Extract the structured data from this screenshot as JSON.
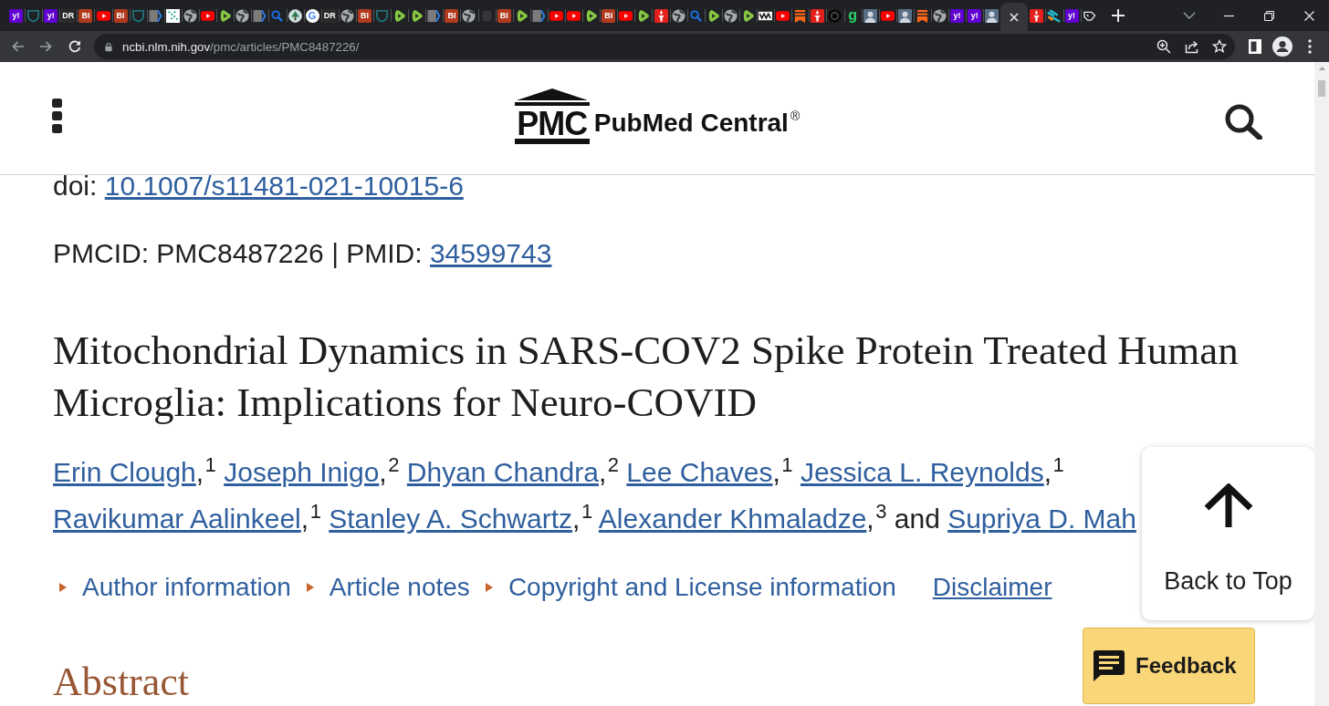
{
  "browser": {
    "tabs": [
      {
        "kind": "tile",
        "glyph": "y!",
        "color": "#6001d2",
        "selected": false
      },
      {
        "kind": "shield",
        "selected": false
      },
      {
        "kind": "tile",
        "glyph": "y!",
        "color": "#6001d2",
        "selected": false
      },
      {
        "kind": "tile",
        "glyph": "DR",
        "color": "#2b2b2b",
        "selected": false
      },
      {
        "kind": "tile",
        "glyph": "BI",
        "color": "#b23a1f",
        "selected": false
      },
      {
        "kind": "video",
        "selected": false
      },
      {
        "kind": "tile",
        "glyph": "BI",
        "color": "#b23a1f",
        "selected": false
      },
      {
        "kind": "shield",
        "selected": false
      },
      {
        "kind": "chevron",
        "selected": false
      },
      {
        "kind": "dots",
        "selected": false
      },
      {
        "kind": "globe",
        "selected": false
      },
      {
        "kind": "video",
        "selected": false
      },
      {
        "kind": "play",
        "selected": false
      },
      {
        "kind": "globe",
        "selected": false
      },
      {
        "kind": "chevron",
        "selected": false
      },
      {
        "kind": "search",
        "selected": false
      },
      {
        "kind": "tree",
        "selected": false
      },
      {
        "kind": "disc",
        "glyph": "G",
        "color": "#4285f4",
        "selected": false
      },
      {
        "kind": "tile",
        "glyph": "DR",
        "color": "#2b2b2b",
        "selected": false
      },
      {
        "kind": "globe",
        "selected": false
      },
      {
        "kind": "tile",
        "glyph": "BI",
        "color": "#b23a1f",
        "selected": false
      },
      {
        "kind": "shield",
        "selected": false
      },
      {
        "kind": "play",
        "selected": false
      },
      {
        "kind": "play",
        "selected": false
      },
      {
        "kind": "chevron",
        "selected": false
      },
      {
        "kind": "tile",
        "glyph": "BI",
        "color": "#b23a1f",
        "selected": false
      },
      {
        "kind": "globe",
        "selected": false
      },
      {
        "kind": "square",
        "selected": false
      },
      {
        "kind": "tile",
        "glyph": "BI",
        "color": "#b23a1f",
        "selected": false
      },
      {
        "kind": "play",
        "selected": false
      },
      {
        "kind": "chevron",
        "selected": false
      },
      {
        "kind": "video",
        "selected": false
      },
      {
        "kind": "video",
        "selected": false
      },
      {
        "kind": "play",
        "selected": false
      },
      {
        "kind": "tile",
        "glyph": "BI",
        "color": "#b23a1f",
        "selected": false
      },
      {
        "kind": "video",
        "selected": false
      },
      {
        "kind": "play",
        "selected": false
      },
      {
        "kind": "torch",
        "selected": false
      },
      {
        "kind": "globe",
        "selected": false
      },
      {
        "kind": "search",
        "selected": false
      },
      {
        "kind": "play",
        "selected": false
      },
      {
        "kind": "globe",
        "selected": false
      },
      {
        "kind": "play",
        "selected": false
      },
      {
        "kind": "zigzag",
        "selected": false
      },
      {
        "kind": "video",
        "selected": false
      },
      {
        "kind": "bookmark",
        "selected": false
      },
      {
        "kind": "torch",
        "selected": false
      },
      {
        "kind": "ring",
        "selected": false
      },
      {
        "kind": "letter",
        "glyph": "g",
        "color": "#27d36b",
        "selected": false
      },
      {
        "kind": "person",
        "selected": false
      },
      {
        "kind": "video",
        "selected": false
      },
      {
        "kind": "person",
        "selected": false
      },
      {
        "kind": "bookmark",
        "selected": false
      },
      {
        "kind": "globe",
        "selected": false
      },
      {
        "kind": "tile",
        "glyph": "y!",
        "color": "#6001d2",
        "selected": false
      },
      {
        "kind": "tile",
        "glyph": "y!",
        "color": "#6001d2",
        "selected": false
      },
      {
        "kind": "person",
        "selected": false
      },
      {
        "selected": true
      },
      {
        "kind": "torch",
        "selected": false
      },
      {
        "kind": "stripes",
        "selected": false
      },
      {
        "kind": "tile",
        "glyph": "y!",
        "color": "#6001d2",
        "selected": false
      },
      {
        "kind": "tag",
        "selected": false
      }
    ],
    "url": {
      "host": "ncbi.nlm.nih.gov",
      "path": "/pmc/articles/PMC8487226/"
    }
  },
  "header": {
    "logo": {
      "mark": "PMC",
      "title": "PubMed Central",
      "registered": "®"
    }
  },
  "article": {
    "doi": {
      "label": "doi:",
      "value": "10.1007/s11481-021-10015-6"
    },
    "ids": {
      "text": "PMCID: PMC8487226 | PMID:",
      "pmid": "34599743"
    },
    "title": "Mitochondrial Dynamics in SARS-COV2 Spike Protein Treated Human Microglia: Implications for Neuro-COVID",
    "authors": {
      "separator": ",",
      "conjunction": "and",
      "names": [
        {
          "name": "Erin Clough",
          "affiliation": "1"
        },
        {
          "name": "Joseph Inigo",
          "affiliation": "2"
        },
        {
          "name": "Dhyan Chandra",
          "affiliation": "2"
        },
        {
          "name": "Lee Chaves",
          "affiliation": "1"
        },
        {
          "name": "Jessica L. Reynolds",
          "affiliation": "1"
        },
        {
          "name": "Ravikumar Aalinkeel",
          "affiliation": "1"
        },
        {
          "name": "Stanley A. Schwartz",
          "affiliation": "1"
        },
        {
          "name": "Alexander Khmaladze",
          "affiliation": "3"
        },
        {
          "name": "Supriya D. Mah"
        }
      ]
    },
    "sections": [
      {
        "kind": "toggle",
        "label": "Author information",
        "expanded": false
      },
      {
        "kind": "toggle",
        "label": "Article notes",
        "expanded": false
      },
      {
        "kind": "toggle",
        "label": "Copyright and License information",
        "expanded": false
      },
      {
        "kind": "link",
        "label": "Disclaimer"
      }
    ],
    "abstract_heading": "Abstract"
  },
  "back_to_top": {
    "label": "Back to Top"
  },
  "feedback": {
    "label": "Feedback"
  }
}
